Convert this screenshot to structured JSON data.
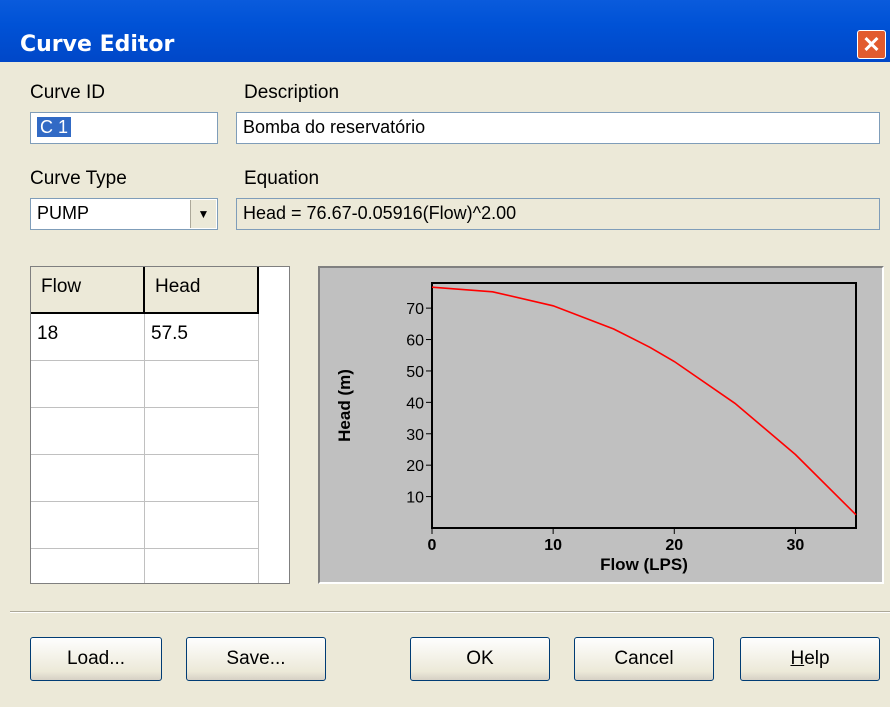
{
  "window": {
    "title": "Curve Editor",
    "close_label": "✕"
  },
  "fields": {
    "curve_id_label": "Curve ID",
    "curve_id_value": "C 1",
    "description_label": "Description",
    "description_value": "Bomba do reservatório",
    "curve_type_label": "Curve Type",
    "curve_type_value": "PUMP",
    "equation_label": "Equation",
    "equation_value": "Head = 76.67-0.05916(Flow)^2.00"
  },
  "table": {
    "columns": [
      "Flow",
      "Head"
    ],
    "rows": [
      [
        "18",
        "57.5"
      ],
      [
        "",
        ""
      ],
      [
        "",
        ""
      ],
      [
        "",
        ""
      ],
      [
        "",
        ""
      ],
      [
        "",
        ""
      ]
    ]
  },
  "chart_data": {
    "type": "line",
    "xlabel": "Flow (LPS)",
    "ylabel": "Head (m)",
    "xlim": [
      0,
      35
    ],
    "ylim": [
      0,
      78
    ],
    "xticks": [
      0,
      10,
      20,
      30
    ],
    "yticks": [
      10,
      20,
      30,
      40,
      50,
      60,
      70
    ],
    "line_color": "#ff0000",
    "series": [
      {
        "x": [
          0,
          5,
          10,
          15,
          18,
          20,
          25,
          30,
          35
        ],
        "y": [
          76.67,
          75.19,
          70.75,
          63.36,
          57.5,
          53.0,
          39.7,
          23.4,
          4.2
        ]
      }
    ]
  },
  "buttons": {
    "load": "Load...",
    "save": "Save...",
    "ok": "OK",
    "cancel": "Cancel",
    "help_pre": "",
    "help_underlined": "H",
    "help_rest": "elp"
  },
  "colors": {
    "titlebar": "#0052d6",
    "dialog_bg": "#ece9d8",
    "chart_bg": "#c0c0c0",
    "selection": "#316ac5"
  }
}
